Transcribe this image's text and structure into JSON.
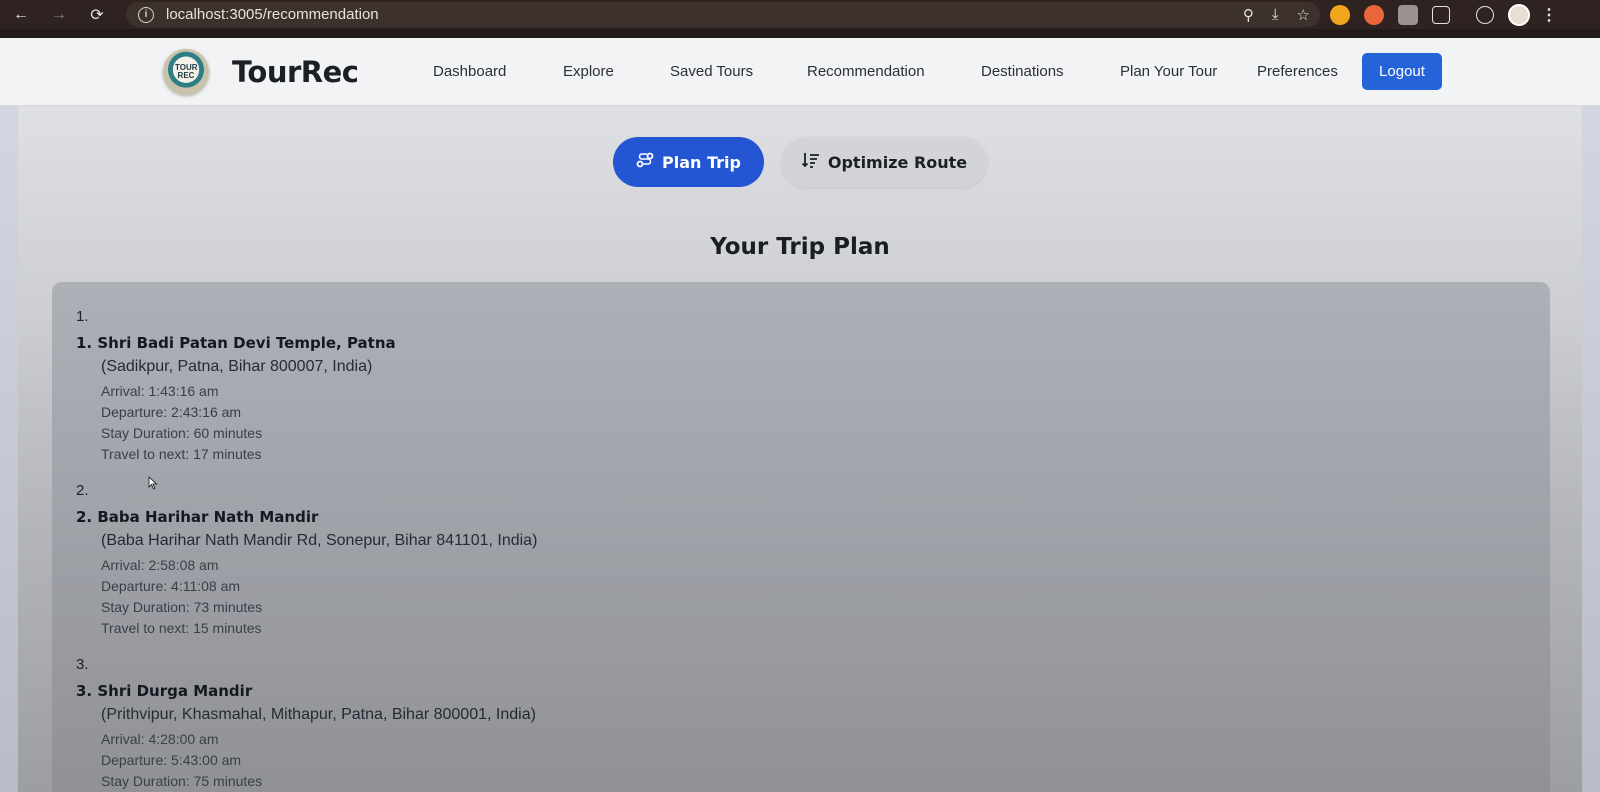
{
  "browser": {
    "url": "localhost:3005/recommendation",
    "back_icon": "←",
    "forward_icon": "→",
    "reload_icon": "⟳",
    "info_icon": "i",
    "location_icon": "⚲",
    "install_icon": "⤓",
    "star_icon": "☆",
    "menu_icon": "⋮"
  },
  "header": {
    "logo_text": "TOUR REC",
    "brand": "TourRec",
    "nav": [
      "Dashboard",
      "Explore",
      "Saved Tours",
      "Recommendation",
      "Destinations",
      "Plan Your Tour",
      "Preferences"
    ],
    "logout_label": "Logout",
    "accent_color": "#2563d9"
  },
  "actions": {
    "plan_trip_label": "Plan Trip",
    "optimize_route_label": "Optimize Route"
  },
  "plan": {
    "title": "Your Trip Plan",
    "stops": [
      {
        "index": "1.",
        "name": "1. Shri Badi Patan Devi Temple, Patna",
        "address": "(Sadikpur, Patna, Bihar 800007, India)",
        "arrival": "Arrival: 1:43:16 am",
        "departure": "Departure: 2:43:16 am",
        "stay": "Stay Duration: 60 minutes",
        "travel": "Travel to next: 17 minutes"
      },
      {
        "index": "2.",
        "name": "2. Baba Harihar Nath Mandir",
        "address": "(Baba Harihar Nath Mandir Rd, Sonepur, Bihar 841101, India)",
        "arrival": "Arrival: 2:58:08 am",
        "departure": "Departure: 4:11:08 am",
        "stay": "Stay Duration: 73 minutes",
        "travel": "Travel to next: 15 minutes"
      },
      {
        "index": "3.",
        "name": "3. Shri Durga Mandir",
        "address": "(Prithvipur, Khasmahal, Mithapur, Patna, Bihar 800001, India)",
        "arrival": "Arrival: 4:28:00 am",
        "departure": "Departure: 5:43:00 am",
        "stay": "Stay Duration: 75 minutes"
      }
    ]
  }
}
